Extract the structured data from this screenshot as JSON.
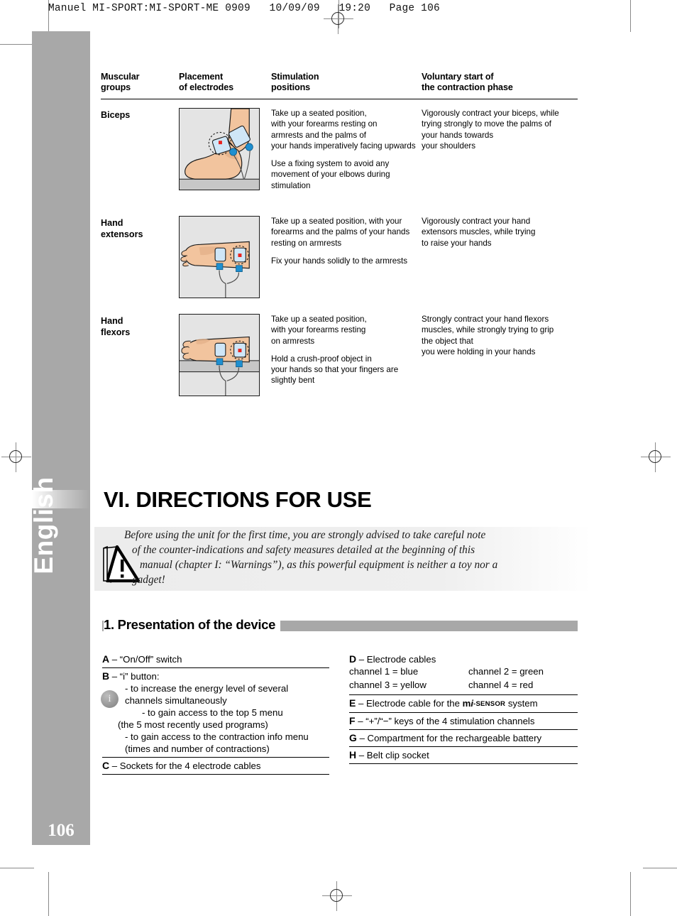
{
  "printer_slug": "Manuel MI-SPORT:MI-SPORT-ME 0909   10/09/09   19:20   Page 106",
  "sidebar": {
    "language": "English",
    "page_number": "106"
  },
  "table": {
    "headers": [
      {
        "line1": "Muscular",
        "line2": "groups"
      },
      {
        "line1": "Placement",
        "line2": "of electrodes"
      },
      {
        "line1": "Stimulation",
        "line2": "positions"
      },
      {
        "line1": "Voluntary start of",
        "line2": "the contraction phase"
      }
    ],
    "rows": [
      {
        "group": {
          "line1": "Biceps",
          "line2": ""
        },
        "figure_name": "biceps-electrode-placement-illustration",
        "stimulation_positions": [
          [
            "Take up a seated position,",
            "with your forearms resting on",
            "armrests and the palms of",
            "your hands imperatively facing upwards"
          ],
          [
            "Use a fixing system to avoid any",
            "movement of your elbows during",
            "stimulation"
          ]
        ],
        "voluntary_start": [
          [
            "Vigorously contract your biceps, while",
            "trying strongly to move the palms of",
            "your hands towards",
            "your shoulders"
          ]
        ]
      },
      {
        "group": {
          "line1": "Hand",
          "line2": "extensors"
        },
        "figure_name": "hand-extensors-electrode-placement-illustration",
        "stimulation_positions": [
          [
            "Take up a seated position, with your",
            "forearms and the palms of your hands",
            "resting on armrests"
          ],
          [
            "Fix your hands solidly to the armrests"
          ]
        ],
        "voluntary_start": [
          [
            "Vigorously contract your hand",
            "extensors muscles, while trying",
            "to raise your hands"
          ]
        ]
      },
      {
        "group": {
          "line1": "Hand",
          "line2": "flexors"
        },
        "figure_name": "hand-flexors-electrode-placement-illustration",
        "stimulation_positions": [
          [
            "Take up a seated position,",
            "with your forearms resting",
            "on armrests"
          ],
          [
            "Hold a crush-proof object in",
            "your hands so that your fingers are",
            "slightly bent"
          ]
        ],
        "voluntary_start": [
          [
            "Strongly contract your hand flexors",
            "muscles, while strongly trying to grip",
            "the object that",
            "you were holding in your hands"
          ]
        ]
      }
    ]
  },
  "chapter": {
    "title": "VI. DIRECTIONS FOR USE",
    "warning": [
      "Before using the unit for the first time, you are strongly advised to take careful note",
      "of the counter-indications and safety measures detailed at the beginning of this",
      "manual (chapter I: “Warnings”), as this powerful equipment is neither a toy nor a",
      "gadget!"
    ]
  },
  "section1": {
    "title": "1. Presentation of the device",
    "left_items": [
      {
        "letter": "A",
        "lines": [
          "– “On/Off” switch"
        ]
      },
      {
        "letter": "B",
        "lines": [
          "– “i” button:"
        ],
        "sub_lines": [
          {
            "indent": 1,
            "text": "- to increase the energy level of several"
          },
          {
            "indent": 1,
            "text": "channels simultaneously"
          },
          {
            "indent": 2,
            "text": "- to gain access to the top 5 menu"
          },
          {
            "indent": 3,
            "text": "(the 5 most recently used programs)"
          },
          {
            "indent": 1,
            "text": "- to gain access to the contraction info menu"
          },
          {
            "indent": 1,
            "text": "(times and number of contractions)"
          }
        ]
      },
      {
        "letter": "C",
        "lines": [
          "– Sockets for the 4 electrode cables"
        ]
      }
    ],
    "right_items": [
      {
        "letter": "D",
        "lines": [
          "– Electrode cables"
        ],
        "channels": [
          "channel 1 = blue",
          "channel 2 = green",
          "channel 3 = yellow",
          "channel 4 = red"
        ]
      },
      {
        "letter": "E",
        "prefix": "– Electrode cable for the ",
        "brand_m": "m",
        "brand_i": "i",
        "brand_sensor": "-SENSOR",
        "suffix": " system"
      },
      {
        "letter": "F",
        "lines": [
          "– “+”/“−” keys of the 4 stimulation channels"
        ]
      },
      {
        "letter": "G",
        "lines": [
          "– Compartment for the rechargeable battery"
        ]
      },
      {
        "letter": "H",
        "lines": [
          "– Belt clip socket"
        ]
      }
    ]
  },
  "colors": {
    "sidebar_gray": "#a8a8a8",
    "skin": "#f0c09a",
    "electrode_blue": "#cfe6f7",
    "connector_blue": "#1e8fd0",
    "marker_red": "#e8231f"
  }
}
